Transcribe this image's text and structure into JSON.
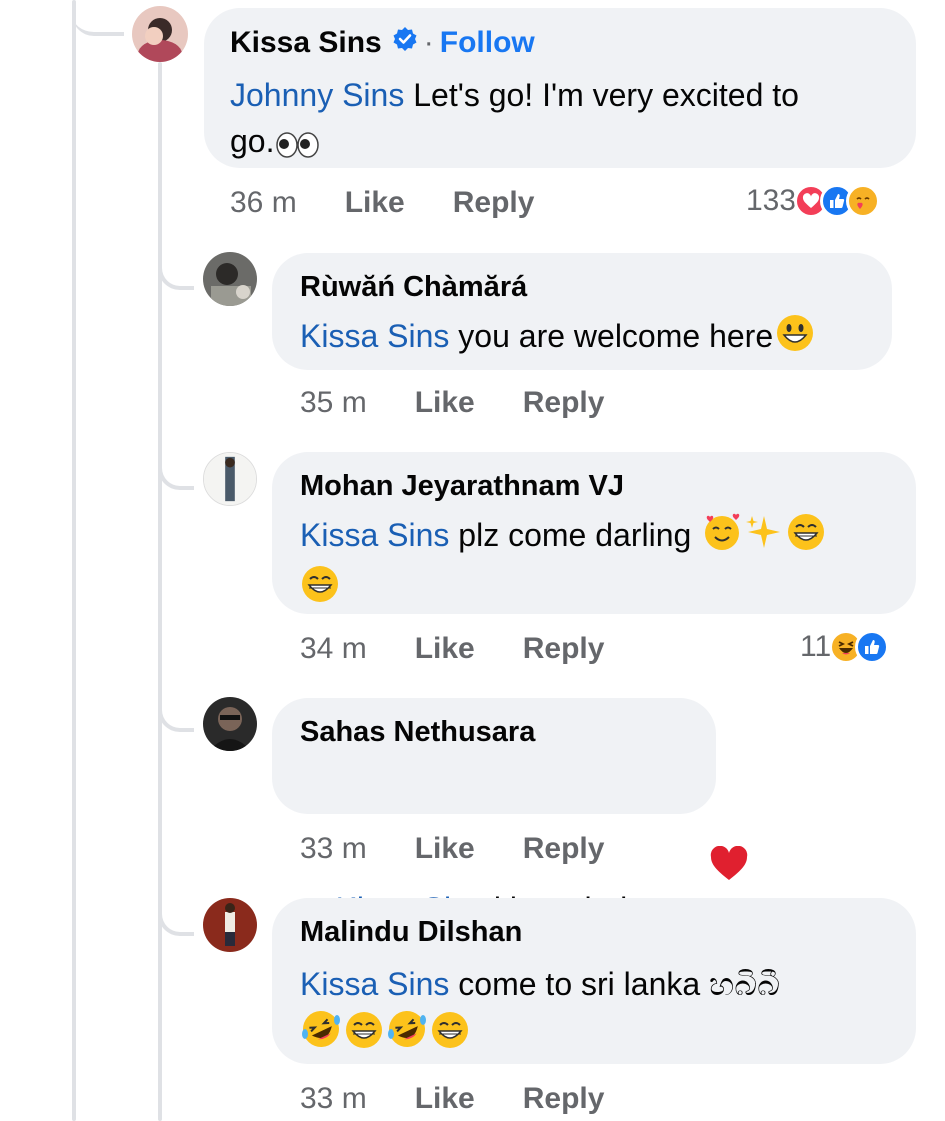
{
  "comments": [
    {
      "author": "Kissa Sins",
      "verified": true,
      "follow_label": "Follow",
      "separator": "·",
      "mention": "Johnny Sins",
      "text": " Let's go! I'm very excited to",
      "text2": "go.",
      "time": "36 m",
      "like_label": "Like",
      "reply_label": "Reply",
      "reaction_count": "133",
      "reactions": [
        "heart-reaction-icon",
        "thumbs-up-reaction-icon",
        "care-reaction-icon"
      ]
    },
    {
      "author": "Rùwăń Chàmărá",
      "mention": "Kissa Sins",
      "text": " you are welcome here",
      "time": "35 m",
      "like_label": "Like",
      "reply_label": "Reply"
    },
    {
      "author": "Mohan Jeyarathnam VJ",
      "mention": "Kissa Sins",
      "text": " plz come darling ",
      "time": "34 m",
      "like_label": "Like",
      "reply_label": "Reply",
      "reaction_count": "11",
      "reactions": [
        "laughing-reaction-icon",
        "thumbs-up-reaction-icon"
      ]
    },
    {
      "author": "Sahas Nethusara",
      "mention": "Kissa Sins",
      "text": " kissa  babe",
      "time": "33 m",
      "like_label": "Like",
      "reply_label": "Reply"
    },
    {
      "author": "Malindu Dilshan",
      "mention": "Kissa Sins",
      "text": " come to sri lanka හබිබී",
      "time": "33 m",
      "like_label": "Like",
      "reply_label": "Reply"
    }
  ],
  "colors": {
    "bubble": "#f0f2f5",
    "mention": "#1a5fb4",
    "follow": "#1877f2",
    "meta": "#65676b",
    "thread_line": "#dfe1e5"
  }
}
